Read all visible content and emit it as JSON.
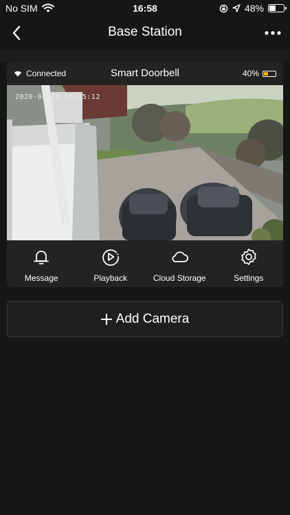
{
  "status_bar": {
    "carrier": "No SIM",
    "time": "16:58",
    "battery_percent_text": "48%",
    "battery_level": 0.48,
    "icons": [
      "wifi-icon",
      "screen-lock-icon",
      "location-icon",
      "battery-icon"
    ]
  },
  "nav": {
    "title": "Base Station",
    "back_icon": "chevron-left-icon",
    "more_icon": "more-horizontal-icon"
  },
  "camera_card": {
    "connection_status": "Connected",
    "name": "Smart Doorbell",
    "battery_text": "40%",
    "battery_level": 0.4,
    "battery_color": "#f5b400",
    "feed_timestamp": "2020-04-10 16:15:12",
    "actions": [
      {
        "label": "Message",
        "icon": "bell-icon"
      },
      {
        "label": "Playback",
        "icon": "playback-icon"
      },
      {
        "label": "Cloud Storage",
        "icon": "cloud-icon"
      },
      {
        "label": "Settings",
        "icon": "gear-icon"
      }
    ]
  },
  "add_camera": {
    "label": "Add Camera",
    "icon": "plus-icon"
  }
}
